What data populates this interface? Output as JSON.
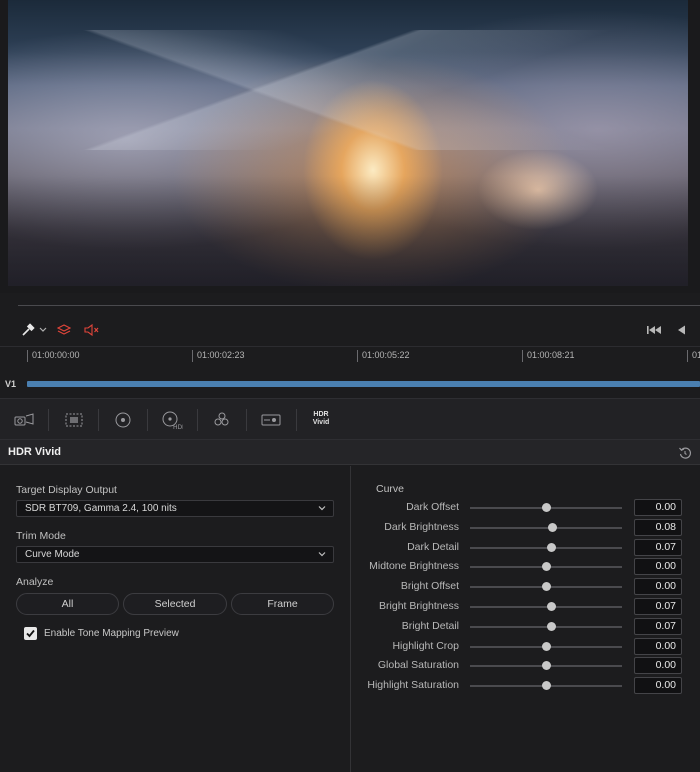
{
  "viewer": {
    "image_alt": "Snowy mountain valley with a large fiery explosion at night"
  },
  "toolbar": {
    "left_icons": [
      "eyedropper-icon",
      "chevron-down-icon",
      "layers-icon",
      "mute-icon"
    ],
    "right_icons": [
      "skip-to-start-icon",
      "play-reverse-icon"
    ]
  },
  "timeline": {
    "timecodes": [
      "01:00:00:00",
      "01:00:02:23",
      "01:00:05:22",
      "01:00:08:21",
      "01"
    ],
    "track_label": "V1"
  },
  "toolstrip": {
    "tools": [
      "camera-raw-icon",
      "color-match-icon",
      "color-wheels-icon",
      "hdr-wheels-icon",
      "rgb-mixer-icon",
      "motion-effects-icon"
    ],
    "hdr_vivid_line1": "HDR",
    "hdr_vivid_line2": "Vivid"
  },
  "panel": {
    "title": "HDR Vivid",
    "target_display_label": "Target Display Output",
    "target_display_value": "SDR BT709, Gamma 2.4, 100 nits",
    "trim_mode_label": "Trim Mode",
    "trim_mode_value": "Curve Mode",
    "analyze_label": "Analyze",
    "analyze_buttons": [
      "All",
      "Selected",
      "Frame"
    ],
    "tone_mapping_label": "Enable Tone Mapping Preview",
    "tone_mapping_checked": true
  },
  "curve": {
    "title": "Curve",
    "params": [
      {
        "label": "Dark Offset",
        "value": "0.00",
        "slider": 0.5
      },
      {
        "label": "Dark Brightness",
        "value": "0.08",
        "slider": 0.54
      },
      {
        "label": "Dark Detail",
        "value": "0.07",
        "slider": 0.53
      },
      {
        "label": "Midtone Brightness",
        "value": "0.00",
        "slider": 0.5
      },
      {
        "label": "Bright Offset",
        "value": "0.00",
        "slider": 0.5
      },
      {
        "label": "Bright Brightness",
        "value": "0.07",
        "slider": 0.53
      },
      {
        "label": "Bright Detail",
        "value": "0.07",
        "slider": 0.53
      },
      {
        "label": "Highlight Crop",
        "value": "0.00",
        "slider": 0.5
      },
      {
        "label": "Global Saturation",
        "value": "0.00",
        "slider": 0.5
      },
      {
        "label": "Highlight Saturation",
        "value": "0.00",
        "slider": 0.5
      }
    ]
  },
  "colors": {
    "accent_red": "#e0453a",
    "track_blue": "#4a7fb0"
  }
}
